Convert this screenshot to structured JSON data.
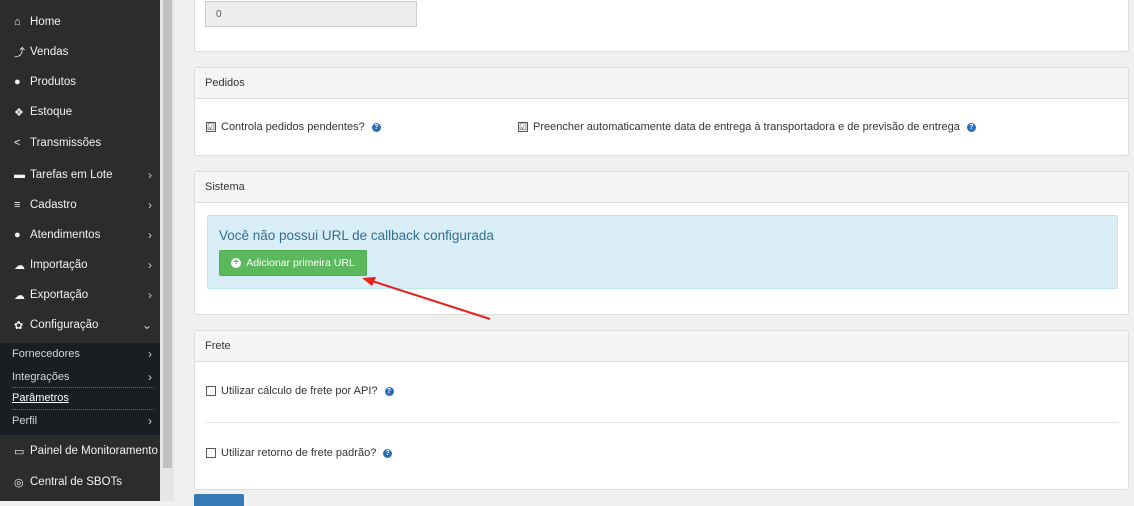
{
  "sidebar": {
    "items": [
      {
        "label": "Home",
        "icon": "home-icon",
        "glyph": "⌂",
        "chevron": ""
      },
      {
        "label": "Vendas",
        "icon": "chart-icon",
        "glyph": "⤴",
        "chevron": ""
      },
      {
        "label": "Produtos",
        "icon": "product-icon",
        "glyph": "●",
        "chevron": ""
      },
      {
        "label": "Estoque",
        "icon": "cubes-icon",
        "glyph": "❖",
        "chevron": ""
      },
      {
        "label": "Transmissões",
        "icon": "share-icon",
        "glyph": "<",
        "chevron": ""
      },
      {
        "label": "Tarefas em Lote",
        "icon": "tasks-icon",
        "glyph": "▬",
        "chevron": "›"
      },
      {
        "label": "Cadastro",
        "icon": "list-icon",
        "glyph": "≡",
        "chevron": "›"
      },
      {
        "label": "Atendimentos",
        "icon": "chat-icon",
        "glyph": "●",
        "chevron": "›"
      },
      {
        "label": "Importação",
        "icon": "cloud-upload-icon",
        "glyph": "☁",
        "chevron": "›"
      },
      {
        "label": "Exportação",
        "icon": "cloud-download-icon",
        "glyph": "☁",
        "chevron": "›"
      },
      {
        "label": "Configuração",
        "icon": "gear-icon",
        "glyph": "✿",
        "chevron": "⌄"
      }
    ],
    "subitems": [
      {
        "label": "Fornecedores",
        "chevron": "›"
      },
      {
        "label": "Integrações",
        "chevron": "›"
      },
      {
        "label": "Parâmetros",
        "chevron": ""
      },
      {
        "label": "Perfil",
        "chevron": "›"
      }
    ],
    "bottom_items": [
      {
        "label": "Painel de Monitoramento",
        "icon": "monitor-icon",
        "glyph": "▭"
      },
      {
        "label": "Central de SBOTs",
        "icon": "bot-icon",
        "glyph": "◎"
      }
    ]
  },
  "top_panel": {
    "input_value": "0"
  },
  "pedidos": {
    "title": "Pedidos",
    "checks": [
      {
        "label": "Controla pedidos pendentes?",
        "checked": "☑"
      },
      {
        "label": "Preencher automaticamente data de entrega à transportadora e de previsão de entrega",
        "checked": "☑"
      }
    ]
  },
  "sistema": {
    "title": "Sistema",
    "alert_text": "Você não possui URL de callback configurada",
    "button_label": "Adicionar primeira URL"
  },
  "frete": {
    "title": "Frete",
    "checks": [
      {
        "label": "Utilizar cálculo de frete por API?",
        "checked": ""
      },
      {
        "label": "Utilizar retorno de frete padrão?",
        "checked": ""
      }
    ]
  },
  "colors": {
    "sidebar_bg": "#2c2c2c",
    "alert_bg": "#d9edf7",
    "button_green": "#5cb85c",
    "help_blue": "#2a6ebb",
    "arrow_red": "#e8211a"
  }
}
